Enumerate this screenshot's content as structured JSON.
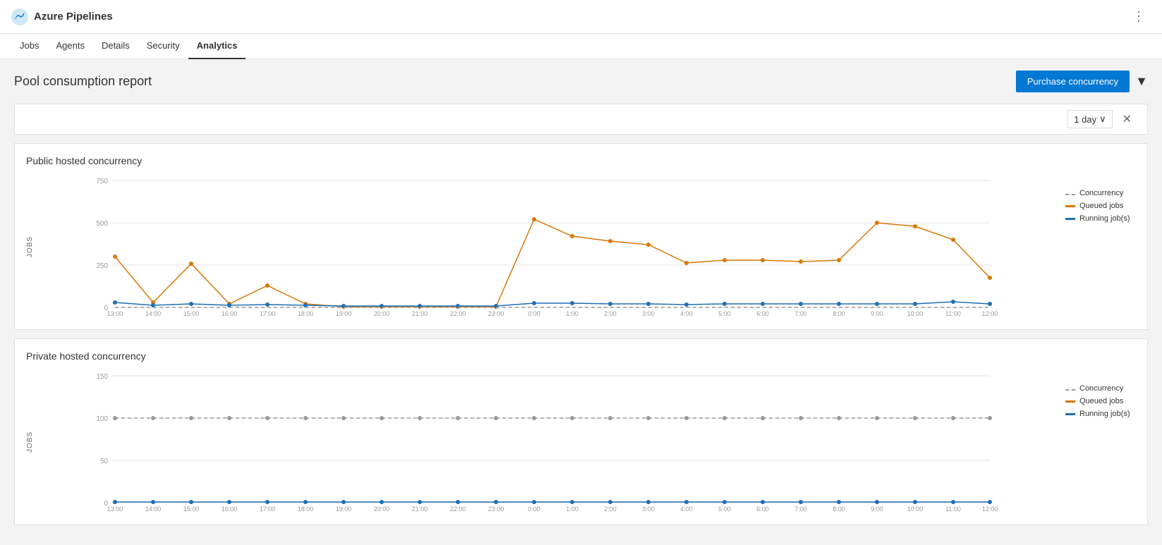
{
  "app": {
    "title": "Azure Pipelines",
    "logo_icon": "☁"
  },
  "nav": {
    "tabs": [
      {
        "id": "jobs",
        "label": "Jobs",
        "active": false
      },
      {
        "id": "agents",
        "label": "Agents",
        "active": false
      },
      {
        "id": "details",
        "label": "Details",
        "active": false
      },
      {
        "id": "security",
        "label": "Security",
        "active": false
      },
      {
        "id": "analytics",
        "label": "Analytics",
        "active": true
      }
    ]
  },
  "page": {
    "title": "Pool consumption report",
    "purchase_button": "Purchase concurrency",
    "day_selector": "1 day"
  },
  "legend": {
    "concurrency": "Concurrency",
    "queued_jobs": "Queued jobs",
    "running_jobs": "Running job(s)"
  },
  "public_chart": {
    "title": "Public hosted concurrency",
    "y_label": "JOBS",
    "y_ticks": [
      "750",
      "500",
      "250",
      "0"
    ],
    "x_labels": [
      "13:00",
      "14:00",
      "15:00",
      "16:00",
      "17:00",
      "18:00",
      "19:00",
      "20:00",
      "21:00",
      "22:00",
      "23:00",
      "0:00",
      "1:00",
      "2:00",
      "3:00",
      "4:00",
      "5:00",
      "6:00",
      "7:00",
      "8:00",
      "9:00",
      "10:00",
      "11:00",
      "12:00"
    ]
  },
  "private_chart": {
    "title": "Private hosted concurrency",
    "y_label": "JOBS",
    "y_ticks": [
      "150",
      "100",
      "50",
      "0"
    ],
    "x_labels": [
      "13:00",
      "14:00",
      "15:00",
      "16:00",
      "17:00",
      "18:00",
      "19:00",
      "20:00",
      "21:00",
      "22:00",
      "23:00",
      "0:00",
      "1:00",
      "2:00",
      "3:00",
      "4:00",
      "5:00",
      "6:00",
      "7:00",
      "8:00",
      "9:00",
      "10:00",
      "11:00",
      "12:00"
    ]
  }
}
